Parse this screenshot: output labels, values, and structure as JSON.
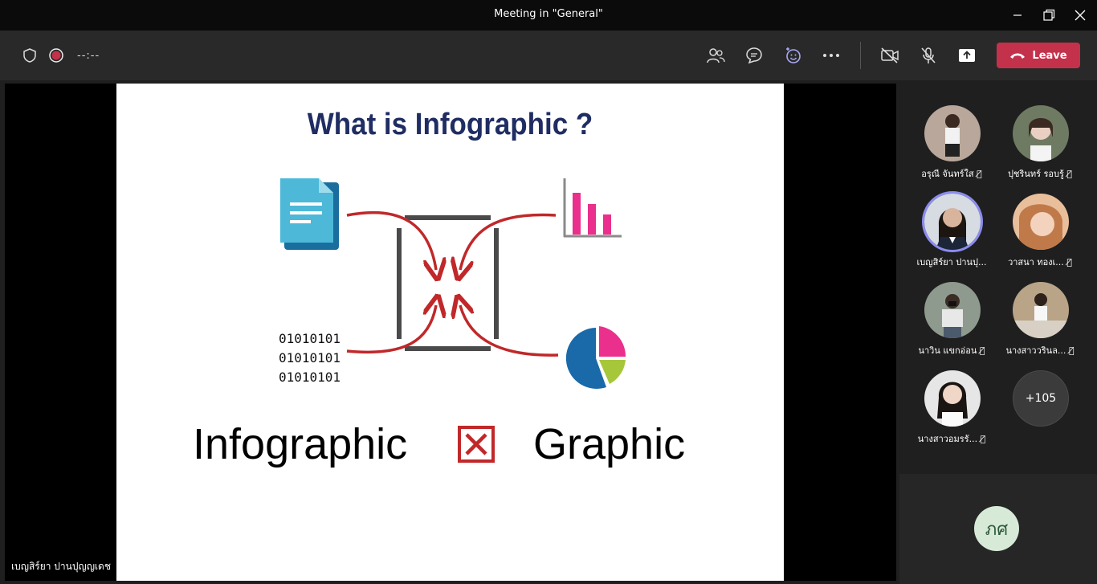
{
  "window": {
    "title": "Meeting in \"General\""
  },
  "toolbar": {
    "timer": "--:--",
    "leave_label": "Leave"
  },
  "slide": {
    "title": "What is Infographic ?",
    "binary_lines": [
      "01010101",
      "01010101",
      "01010101"
    ],
    "left_word": "Infographic",
    "right_word": "Graphic"
  },
  "presenter": {
    "name": "เบญสิร์ยา ปานปุญญเดช"
  },
  "participants": [
    {
      "name": "อรุณี จันทร์ใส",
      "muted": true
    },
    {
      "name": "ปุชรินทร์ รอบรู้",
      "muted": true
    },
    {
      "name": "เบญสิร์ยา ปานปุ...",
      "muted": false,
      "active": true
    },
    {
      "name": "วาสนา ทองเ...",
      "muted": true
    },
    {
      "name": "นาวิน แขกอ่อน",
      "muted": true
    },
    {
      "name": "นางสาววรินล...",
      "muted": true
    },
    {
      "name": "นางสาวอมรรั...",
      "muted": true
    }
  ],
  "overflow_count": "+105",
  "self": {
    "initials": "ภศ"
  },
  "colors": {
    "leave": "#c4314b",
    "active_ring": "#8b8cf0",
    "arrow": "#c0282a",
    "title": "#1f2d63"
  }
}
